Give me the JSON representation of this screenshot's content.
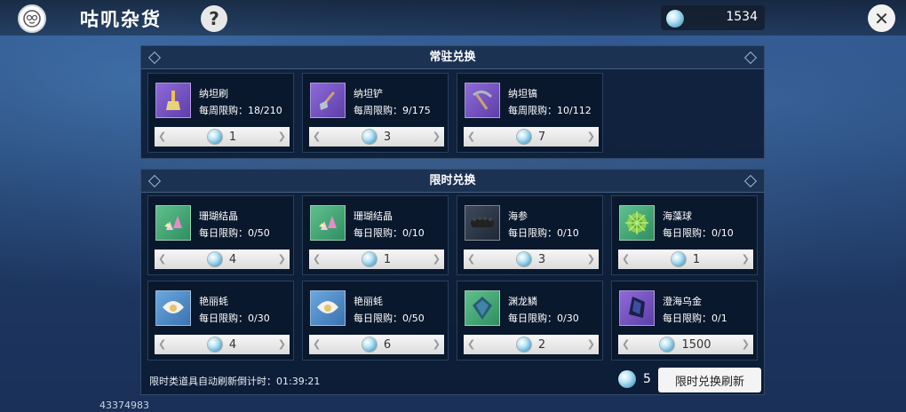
{
  "header": {
    "title": "咕叽杂货",
    "help_label": "?",
    "currency_amount": "1534",
    "close_label": "✕"
  },
  "permanent": {
    "section_title": "常驻兑换",
    "items": [
      {
        "name": "纳坦刷",
        "limit": "每周限购：18/210",
        "price": "1",
        "icon": "brush-icon"
      },
      {
        "name": "纳坦铲",
        "limit": "每周限购：9/175",
        "price": "3",
        "icon": "shovel-icon"
      },
      {
        "name": "纳坦镐",
        "limit": "每周限购：10/112",
        "price": "7",
        "icon": "pickaxe-icon"
      }
    ]
  },
  "limited": {
    "section_title": "限时兑换",
    "items": [
      {
        "name": "珊瑚结晶",
        "limit": "每日限购：0/50",
        "price": "4",
        "icon": "coral-crystal-icon"
      },
      {
        "name": "珊瑚结晶",
        "limit": "每日限购：0/10",
        "price": "1",
        "icon": "coral-crystal-icon"
      },
      {
        "name": "海参",
        "limit": "每日限购：0/10",
        "price": "3",
        "icon": "sea-cucumber-icon"
      },
      {
        "name": "海藻球",
        "limit": "每日限购：0/10",
        "price": "1",
        "icon": "seaweed-ball-icon"
      },
      {
        "name": "艳丽蚝",
        "limit": "每日限购：0/30",
        "price": "4",
        "icon": "oyster-icon"
      },
      {
        "name": "艳丽蚝",
        "limit": "每日限购：0/50",
        "price": "6",
        "icon": "oyster-icon"
      },
      {
        "name": "渊龙鳞",
        "limit": "每日限购：0/30",
        "price": "2",
        "icon": "dragon-scale-icon"
      },
      {
        "name": "澄海乌金",
        "limit": "每日限购：0/1",
        "price": "1500",
        "icon": "black-gold-icon"
      }
    ]
  },
  "footer": {
    "timer_text": "限时类道具自动刷新倒计时：01:39:21",
    "refresh_cost": "5",
    "refresh_button_label": "限时兑换刷新",
    "uid": "43374983"
  }
}
